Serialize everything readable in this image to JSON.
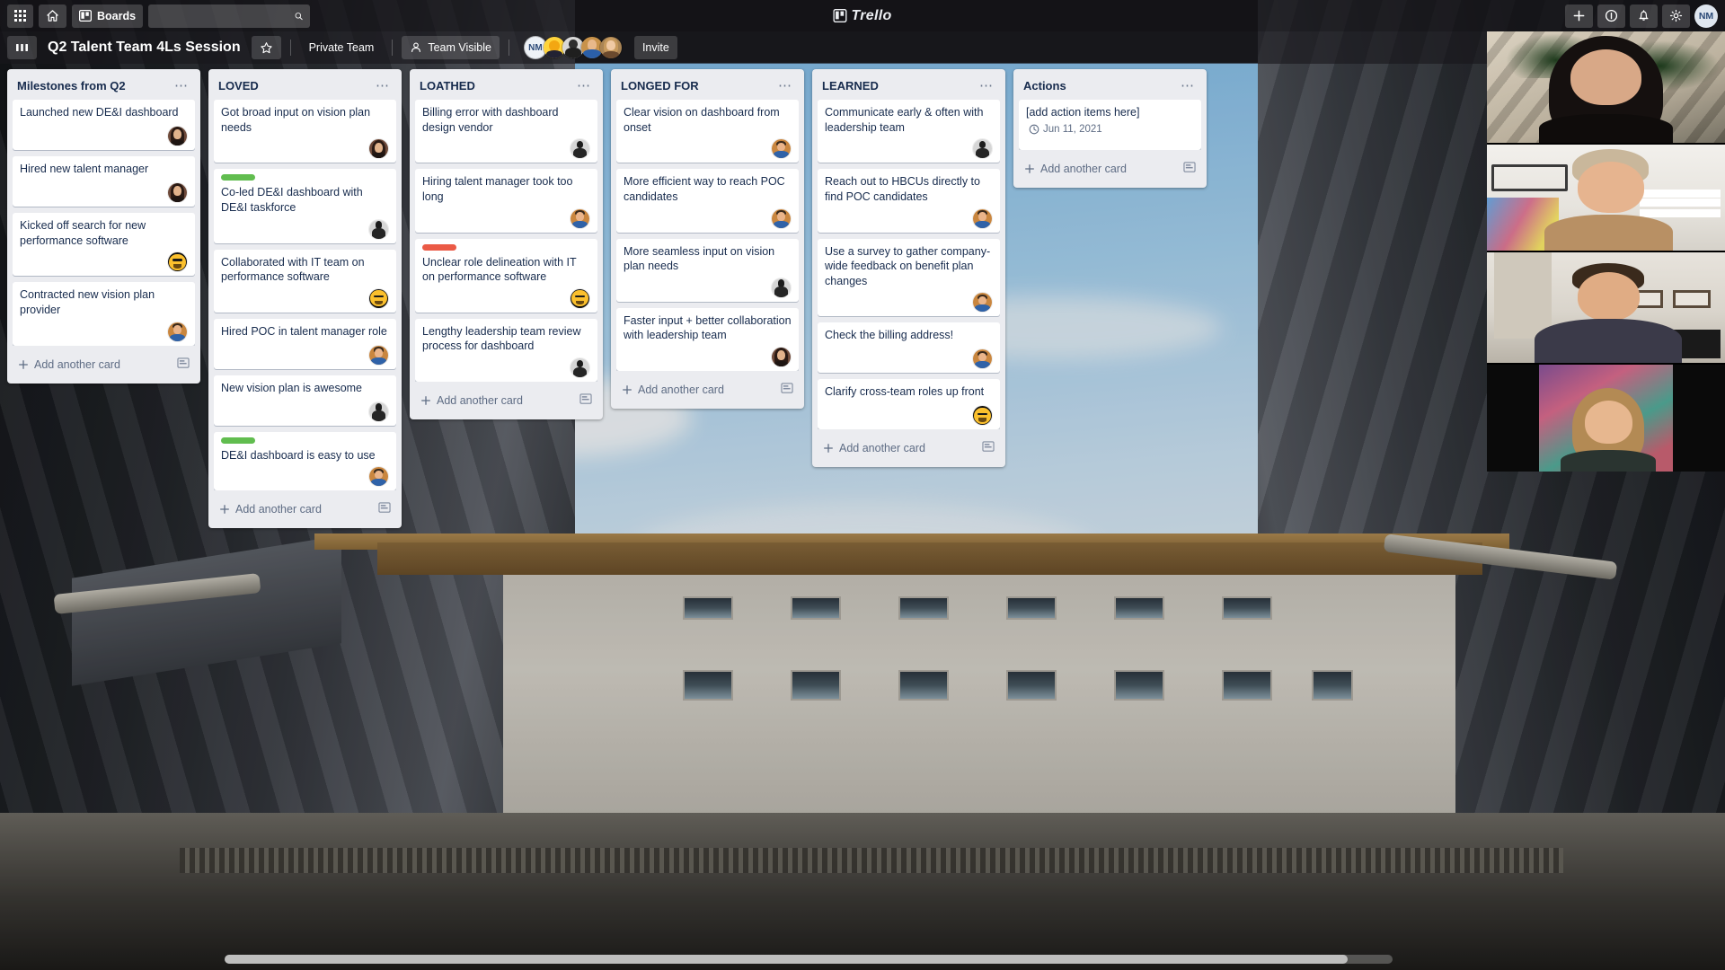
{
  "topnav": {
    "apps_icon": "grid-apps-icon",
    "home_icon": "home-icon",
    "boards_icon": "board-icon",
    "boards_label": "Boards",
    "search_placeholder": "",
    "search_value": "",
    "search_icon": "search-icon",
    "logo_text": "Trello",
    "logo_icon": "trello-board-icon",
    "add_icon": "plus-icon",
    "info_icon": "info-circle-icon",
    "bell_icon": "bell-icon",
    "gear_icon": "gear-icon",
    "user_initials": "NM"
  },
  "boardheader": {
    "board_switch_icon": "board-columns-icon",
    "title": "Q2 Talent Team 4Ls Session",
    "star_icon": "star-icon",
    "visibility_team": "Private Team",
    "visibility_label": "Team Visible",
    "visibility_icon": "people-icon",
    "member_initials": "NM",
    "invite_label": "Invite"
  },
  "lists": [
    {
      "title": "Milestones from Q2",
      "menu_icon": "ellipsis-icon",
      "add_card_label": "Add another card",
      "add_icon": "plus-icon",
      "template_icon": "template-card-icon",
      "cards": [
        {
          "text": "Launched new DE&I dashboard",
          "label": null,
          "avatar": "avatar-woman-dark",
          "date": null
        },
        {
          "text": "Hired new talent manager",
          "label": null,
          "avatar": "avatar-woman-dark",
          "date": null
        },
        {
          "text": "Kicked off search for new performance software",
          "label": null,
          "avatar": "avatar-yellow-emoji",
          "date": null
        },
        {
          "text": "Contracted new vision plan provider",
          "label": null,
          "avatar": "avatar-man-blue",
          "date": null
        }
      ]
    },
    {
      "title": "LOVED",
      "menu_icon": "ellipsis-icon",
      "add_card_label": "Add another card",
      "add_icon": "plus-icon",
      "template_icon": "template-card-icon",
      "cards": [
        {
          "text": "Got broad input on vision plan needs",
          "label": null,
          "avatar": "avatar-woman-dark",
          "date": null
        },
        {
          "text": "Co-led DE&I dashboard with DE&I taskforce",
          "label": "#61bd4f",
          "avatar": "avatar-dark-silhouette",
          "date": null
        },
        {
          "text": "Collaborated with IT team on performance software",
          "label": null,
          "avatar": "avatar-yellow-emoji",
          "date": null
        },
        {
          "text": "Hired POC in talent manager role",
          "label": null,
          "avatar": "avatar-man-blue",
          "date": null
        },
        {
          "text": "New vision plan is awesome",
          "label": null,
          "avatar": "avatar-dark-silhouette",
          "date": null
        },
        {
          "text": "DE&I dashboard is easy to use",
          "label": "#61bd4f",
          "avatar": "avatar-man-blue",
          "date": null
        }
      ]
    },
    {
      "title": "LOATHED",
      "menu_icon": "ellipsis-icon",
      "add_card_label": "Add another card",
      "add_icon": "plus-icon",
      "template_icon": "template-card-icon",
      "cards": [
        {
          "text": "Billing error with dashboard design vendor",
          "label": null,
          "avatar": "avatar-dark-silhouette",
          "date": null
        },
        {
          "text": "Hiring talent manager took too long",
          "label": null,
          "avatar": "avatar-man-blue",
          "date": null
        },
        {
          "text": "Unclear role delineation with IT on performance software",
          "label": "#eb5a46",
          "avatar": "avatar-yellow-emoji",
          "date": null
        },
        {
          "text": "Lengthy leadership team review process for dashboard",
          "label": null,
          "avatar": "avatar-dark-silhouette",
          "date": null
        }
      ]
    },
    {
      "title": "LONGED FOR",
      "menu_icon": "ellipsis-icon",
      "add_card_label": "Add another card",
      "add_icon": "plus-icon",
      "template_icon": "template-card-icon",
      "cards": [
        {
          "text": "Clear vision on dashboard from onset",
          "label": null,
          "avatar": "avatar-man-blue",
          "date": null
        },
        {
          "text": "More efficient way to reach POC candidates",
          "label": null,
          "avatar": "avatar-man-blue",
          "date": null
        },
        {
          "text": "More seamless input on vision plan needs",
          "label": null,
          "avatar": "avatar-dark-silhouette",
          "date": null
        },
        {
          "text": "Faster input + better collaboration with leadership team",
          "label": null,
          "avatar": "avatar-woman-dark",
          "date": null
        }
      ]
    },
    {
      "title": "LEARNED",
      "menu_icon": "ellipsis-icon",
      "add_card_label": "Add another card",
      "add_icon": "plus-icon",
      "template_icon": "template-card-icon",
      "cards": [
        {
          "text": "Communicate early & often with leadership team",
          "label": null,
          "avatar": "avatar-dark-silhouette",
          "date": null
        },
        {
          "text": "Reach out to HBCUs directly to find POC candidates",
          "label": null,
          "avatar": "avatar-man-blue",
          "date": null
        },
        {
          "text": "Use a survey to gather company-wide feedback on benefit plan changes",
          "label": null,
          "avatar": "avatar-man-blue",
          "date": null
        },
        {
          "text": "Check the billing address!",
          "label": null,
          "avatar": "avatar-man-blue",
          "date": null
        },
        {
          "text": "Clarify cross-team roles up front",
          "label": null,
          "avatar": "avatar-yellow-emoji",
          "date": null
        }
      ]
    },
    {
      "title": "Actions",
      "menu_icon": "ellipsis-icon",
      "add_card_label": "Add another card",
      "add_icon": "plus-icon",
      "template_icon": "template-card-icon",
      "cards": [
        {
          "text": "[add action items here]",
          "label": null,
          "avatar": null,
          "date": "Jun 11, 2021",
          "date_icon": "clock-icon"
        }
      ]
    }
  ],
  "video_panel": {
    "participants": [
      {
        "name": "participant-1"
      },
      {
        "name": "participant-2"
      },
      {
        "name": "participant-3"
      },
      {
        "name": "participant-4"
      }
    ]
  },
  "scrollbar": {
    "name": "horizontal-scrollbar"
  },
  "colors": {
    "label_green": "#61bd4f",
    "label_red": "#eb5a46",
    "list_bg": "#ebecf0",
    "card_text": "#172b4d",
    "muted_text": "#5e6c84"
  }
}
